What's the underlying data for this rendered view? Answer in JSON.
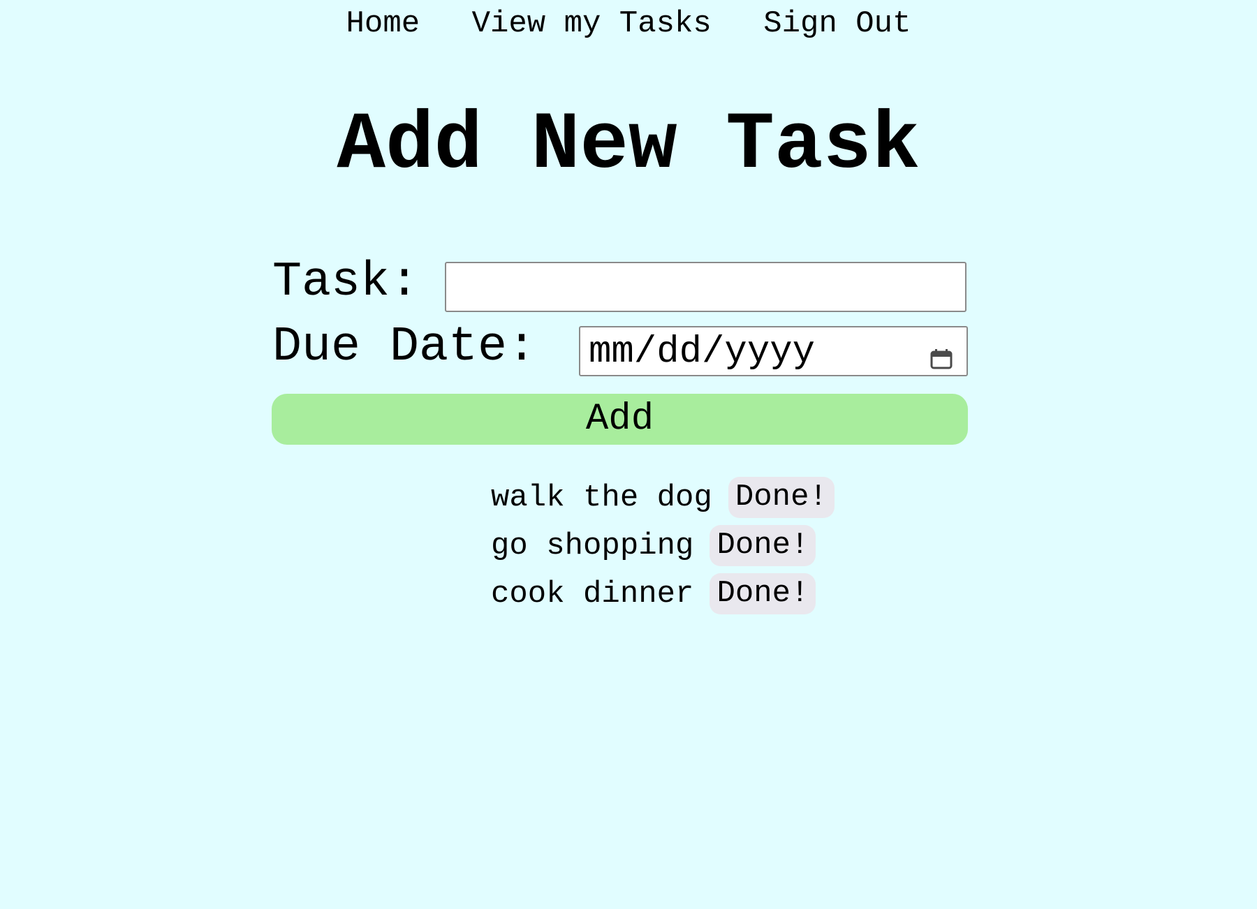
{
  "nav": {
    "home": "Home",
    "view_tasks": "View my Tasks",
    "sign_out": "Sign Out"
  },
  "page_title": "Add New Task",
  "form": {
    "task_label": "Task:",
    "task_value": "",
    "due_date_label": "Due Date:",
    "due_date_placeholder": "mm/dd/yyyy",
    "add_label": "Add"
  },
  "tasks": [
    {
      "text": "walk the dog",
      "done_label": "Done!"
    },
    {
      "text": "go shopping",
      "done_label": "Done!"
    },
    {
      "text": "cook dinner",
      "done_label": "Done!"
    }
  ],
  "icons": {
    "date_picker": "calendar-icon"
  },
  "colors": {
    "background": "#e1fdff",
    "add_button": "#a8ed9d",
    "done_button": "#e9e8ee"
  }
}
